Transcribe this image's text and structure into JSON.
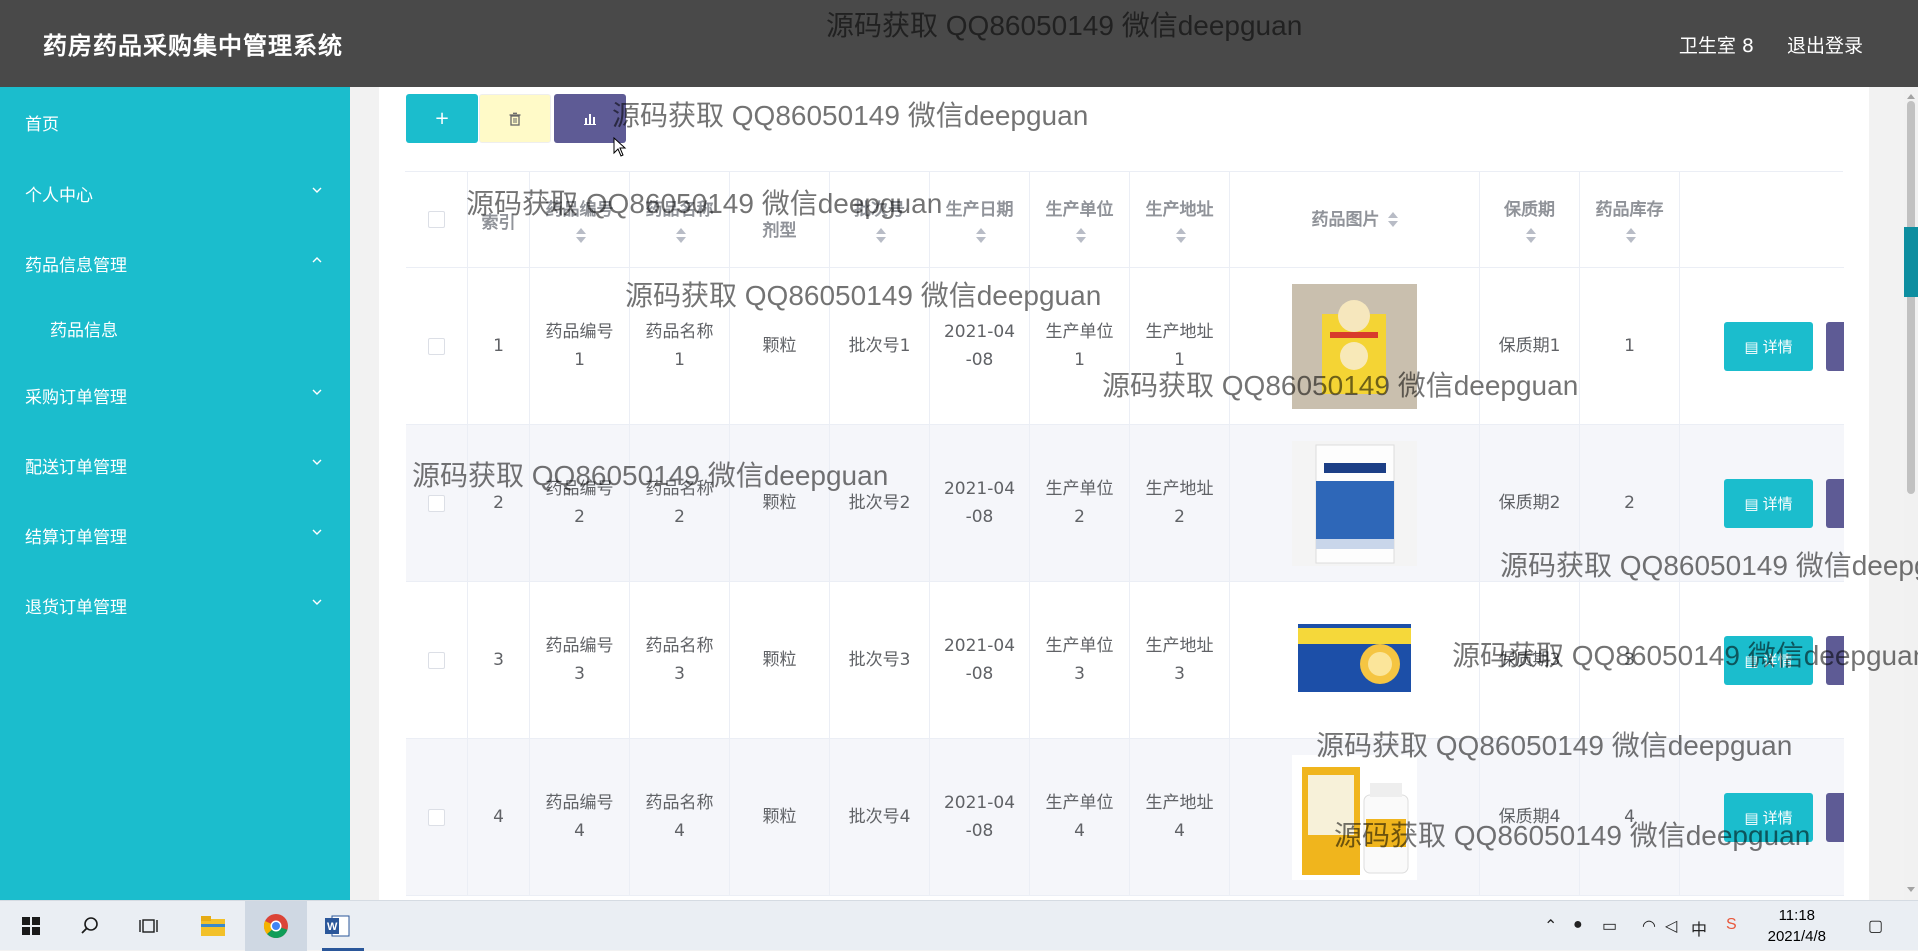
{
  "header": {
    "title": "药房药品采购集中管理系统",
    "user": "卫生室 8",
    "logout": "退出登录"
  },
  "sidebar": {
    "items": [
      {
        "label": "首页",
        "has_chevron": false,
        "expanded": false
      },
      {
        "label": "个人中心",
        "has_chevron": true,
        "expanded": false
      },
      {
        "label": "药品信息管理",
        "has_chevron": true,
        "expanded": true
      },
      {
        "label": "药品信息",
        "sub": true
      },
      {
        "label": "采购订单管理",
        "has_chevron": true,
        "expanded": false
      },
      {
        "label": "配送订单管理",
        "has_chevron": true,
        "expanded": false
      },
      {
        "label": "结算订单管理",
        "has_chevron": true,
        "expanded": false
      },
      {
        "label": "退货订单管理",
        "has_chevron": true,
        "expanded": false
      }
    ]
  },
  "toolbar": {
    "add_icon": "plus-icon",
    "delete_icon": "trash-icon",
    "chart_icon": "bar-chart-icon",
    "add_symbol": "+"
  },
  "table": {
    "headers": [
      "索引",
      "药品编号",
      "药品名称",
      "剂型",
      "批次号",
      "生产日期",
      "生产单位",
      "生产地址",
      "药品图片",
      "保质期",
      "药品库存"
    ],
    "rows": [
      {
        "index": "1",
        "code_a": "药品编号",
        "code_b": "1",
        "name_a": "药品名称",
        "name_b": "1",
        "form": "颗粒",
        "batch": "批次号1",
        "date_a": "2021-04",
        "date_b": "-08",
        "maker_a": "生产单位",
        "maker_b": "1",
        "addr_a": "生产地址",
        "addr_b": "1",
        "shelf": "保质期1",
        "stock": "1",
        "detail": "详情"
      },
      {
        "index": "2",
        "code_a": "药品编号",
        "code_b": "2",
        "name_a": "药品名称",
        "name_b": "2",
        "form": "颗粒",
        "batch": "批次号2",
        "date_a": "2021-04",
        "date_b": "-08",
        "maker_a": "生产单位",
        "maker_b": "2",
        "addr_a": "生产地址",
        "addr_b": "2",
        "shelf": "保质期2",
        "stock": "2",
        "detail": "详情"
      },
      {
        "index": "3",
        "code_a": "药品编号",
        "code_b": "3",
        "name_a": "药品名称",
        "name_b": "3",
        "form": "颗粒",
        "batch": "批次号3",
        "date_a": "2021-04",
        "date_b": "-08",
        "maker_a": "生产单位",
        "maker_b": "3",
        "addr_a": "生产地址",
        "addr_b": "3",
        "shelf": "保质期3",
        "stock": "3",
        "detail": "详情"
      },
      {
        "index": "4",
        "code_a": "药品编号",
        "code_b": "4",
        "name_a": "药品名称",
        "name_b": "4",
        "form": "颗粒",
        "batch": "批次号4",
        "date_a": "2021-04",
        "date_b": "-08",
        "maker_a": "生产单位",
        "maker_b": "4",
        "addr_a": "生产地址",
        "addr_b": "4",
        "shelf": "保质期4",
        "stock": "4",
        "detail": "详情"
      }
    ]
  },
  "watermark": "源码获取 QQ86050149 微信deepguan",
  "taskbar": {
    "time": "11:18",
    "date": "2021/4/8",
    "ime": "中"
  },
  "colors": {
    "accent": "#1bbdcd",
    "header": "#494949",
    "purple": "#5e5b95",
    "yellow": "#fffac8"
  }
}
